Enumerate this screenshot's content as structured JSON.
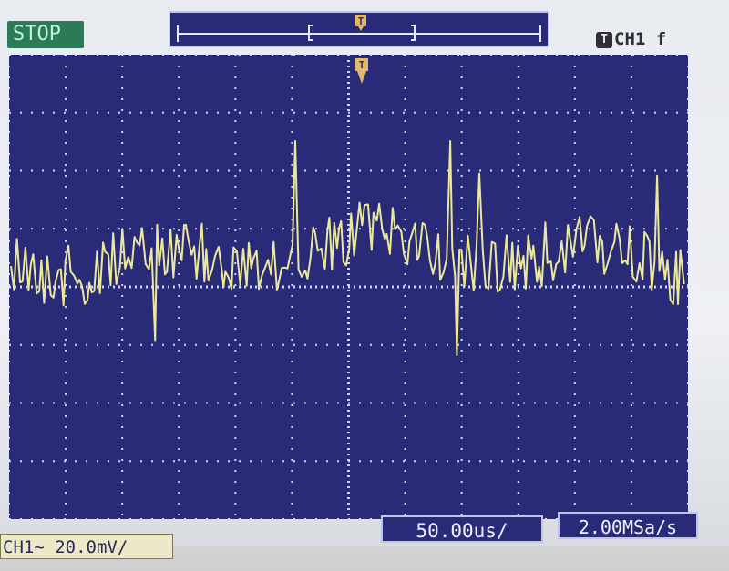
{
  "status": {
    "label": "STOP",
    "color": "#2b7a58"
  },
  "trigger": {
    "badge_label": "T"
  },
  "channel_indicator": {
    "label": "CH1",
    "slope_symbol": "f",
    "icon": "trigger-badge-icon"
  },
  "ch1_scale": {
    "label": "CH1~ 20.0mV/"
  },
  "timebase": {
    "label": "50.00us/"
  },
  "sample_rate": {
    "label": "2.00MSa/s"
  },
  "colors": {
    "grid_bg": "#2a2b78",
    "grid_dots": "#cfd3ff",
    "trace": "#ece89a",
    "accent_orange": "#e3b86a"
  }
}
